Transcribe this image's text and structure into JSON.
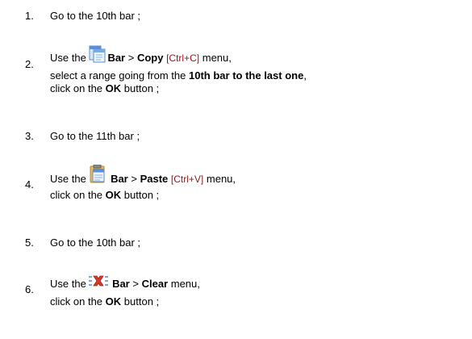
{
  "steps": [
    {
      "number": "1.",
      "text": "Go to the 10th bar ;"
    },
    {
      "number": "2.",
      "use": "Use the",
      "icon": "copy-bar-icon",
      "menu": "Bar",
      "sep": ">",
      "command": "Copy",
      "shortcut": "[Ctrl+C]",
      "menu_word": "menu,",
      "line2_pre": "select a range going from the",
      "line2_bold": "10th bar to the last one",
      "line2_post": ",",
      "line3_pre": "click on the",
      "line3_bold": "OK",
      "line3_post": "button ;"
    },
    {
      "number": "3.",
      "text": "Go to the 11th bar ;"
    },
    {
      "number": "4.",
      "use": "Use the",
      "icon": "paste-bar-icon",
      "menu": "Bar",
      "sep": ">",
      "command": "Paste",
      "shortcut": "[Ctrl+V]",
      "menu_word": "menu,",
      "line2_pre": "click on the",
      "line2_bold": "OK",
      "line2_post": "button ;"
    },
    {
      "number": "5.",
      "text": "Go to the 10th bar ;"
    },
    {
      "number": "6.",
      "use": "Use the",
      "icon": "clear-bar-icon",
      "menu": "Bar",
      "sep": ">",
      "command": "Clear",
      "menu_word": "menu,",
      "line2_pre": "click on the",
      "line2_bold": "OK",
      "line2_post": "button ;"
    }
  ],
  "colors": {
    "text": "#000000",
    "shortcut": "#8b1a1a",
    "icon_blue": "#5a8ed6",
    "icon_red": "#d93a2b"
  }
}
